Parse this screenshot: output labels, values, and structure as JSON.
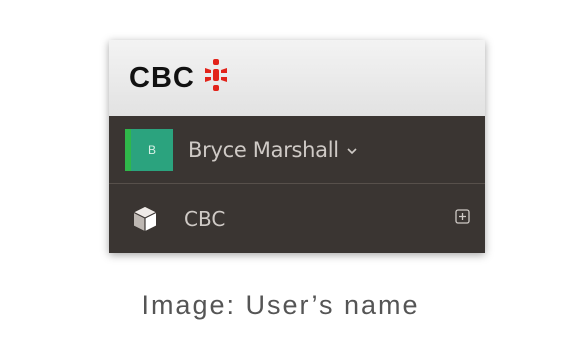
{
  "brand": {
    "name": "CBC",
    "mark_icon": "cbc-gem-icon",
    "mark_color": "#e2231a"
  },
  "user": {
    "avatar_initial": "B",
    "avatar_color": "#2ba37e",
    "avatar_stripe_color": "#2fb84a",
    "name": "Bryce Marshall",
    "menu_icon": "chevron-down-icon"
  },
  "nav": {
    "items": [
      {
        "label": "CBC",
        "icon": "cube-icon",
        "expand_icon": "plus-square-icon"
      }
    ]
  },
  "caption": {
    "text": "Image: User’s name"
  },
  "colors": {
    "sidebar_bg": "#3a3532",
    "header_bg": "#e8e8e8",
    "text_light": "#cfcac6"
  }
}
